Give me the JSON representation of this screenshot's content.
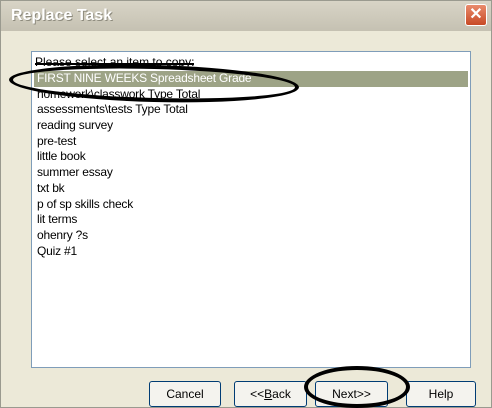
{
  "window": {
    "title": "Replace Task",
    "close_glyph": "✕"
  },
  "dialog": {
    "prompt": "Please select an item to copy:",
    "items": [
      "FIRST NINE WEEKS Spreadsheet Grade",
      "homework\\classwork Type Total",
      "assessments\\tests Type Total",
      "reading survey",
      "pre-test",
      "little book",
      "summer essay",
      "txt bk",
      "p of sp skills check",
      "lit terms",
      "ohenry ?s",
      "Quiz #1"
    ],
    "selected_index": 0
  },
  "buttons": {
    "cancel": "Cancel",
    "back_prefix": "<<",
    "back_accel": "B",
    "back_rest": "ack",
    "next": "Next>>",
    "help": "Help"
  },
  "colors": {
    "selection": "#9da386",
    "annotation_ellipse": "#000000"
  }
}
